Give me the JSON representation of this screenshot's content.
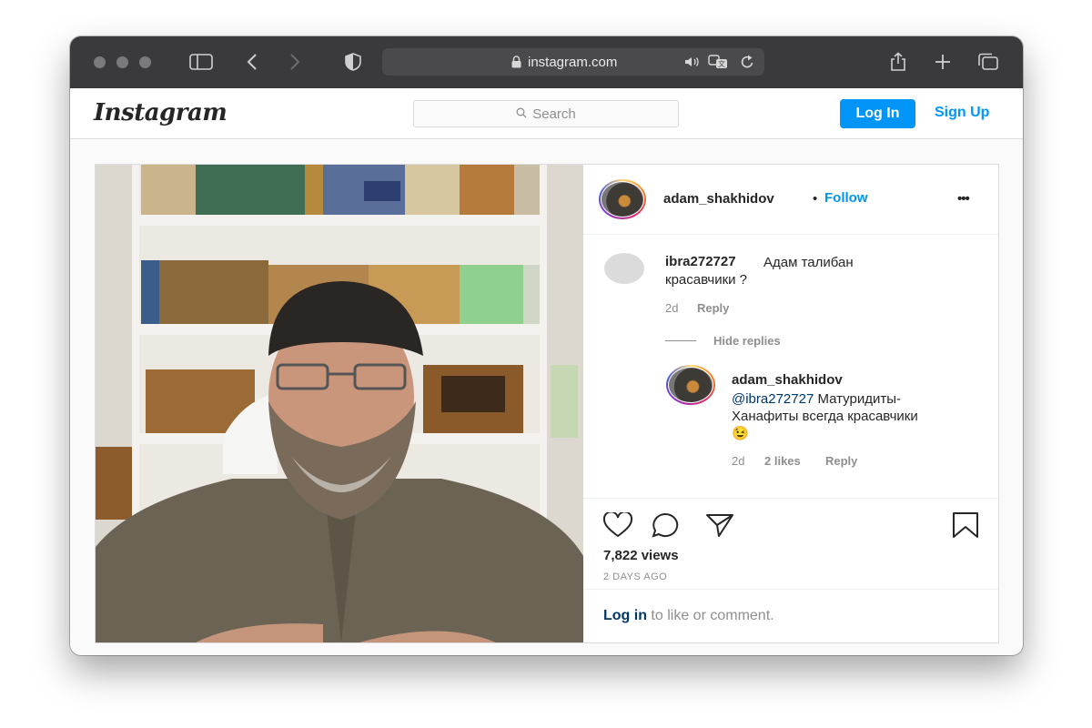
{
  "browser": {
    "url": "instagram.com"
  },
  "header": {
    "logo": "Instagram",
    "search_placeholder": "Search",
    "login_label": "Log In",
    "signup_label": "Sign Up"
  },
  "post": {
    "author": "adam_shakhidov",
    "follow_separator": "•",
    "follow_label": "Follow",
    "more_label": "•••",
    "comments": [
      {
        "username": "ibra272727",
        "text_line1": "Адам талибан",
        "text_line2": "красавчики ?",
        "age": "2d",
        "reply_label": "Reply",
        "hide_replies_label": "Hide replies",
        "replies": [
          {
            "username": "adam_shakhidov",
            "mention": "@ibra272727",
            "text_line1": " Матуридиты-",
            "text_line2": "Ханафиты всегда красавчики",
            "emoji": "😉",
            "age": "2d",
            "likes": "2 likes",
            "reply_label": "Reply"
          }
        ]
      }
    ],
    "views": "7,822 views",
    "posted": "2 DAYS AGO",
    "login_prompt_link": "Log in",
    "login_prompt_rest": " to like or comment."
  },
  "colors": {
    "accent": "#0095f6",
    "toolbar": "#3a3a3c",
    "text": "#262626",
    "muted": "#8e8e8e"
  }
}
